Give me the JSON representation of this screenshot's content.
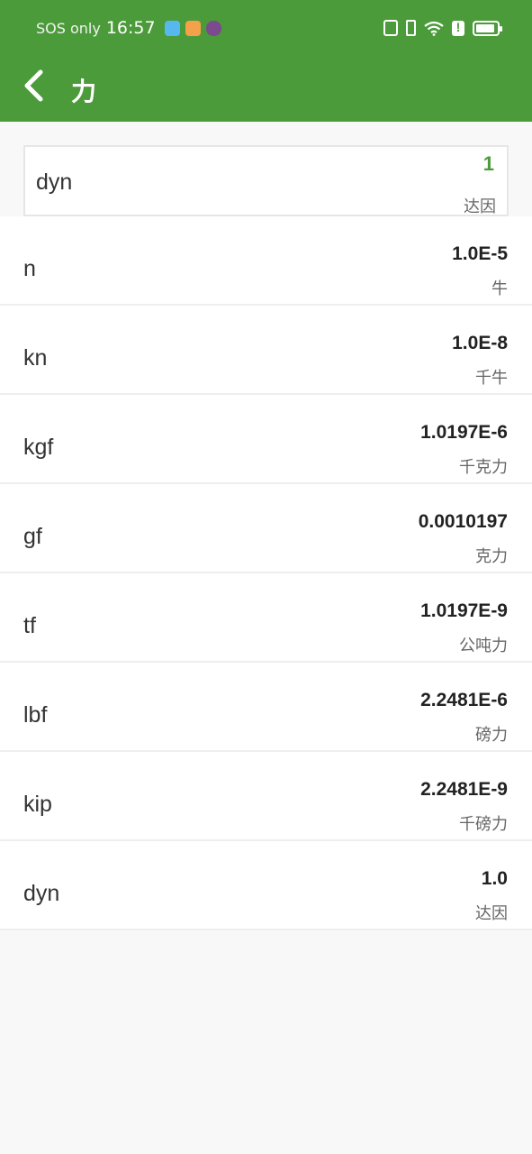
{
  "status_bar": {
    "carrier": "SOS only",
    "time": "16:57"
  },
  "header": {
    "title": "力",
    "back_icon": "chevron-left-icon",
    "color": "#4c9b3a"
  },
  "input": {
    "unit": "dyn",
    "value": "1",
    "name": "达因",
    "value_color": "#4c9b3a"
  },
  "results": [
    {
      "unit": "n",
      "value": "1.0E-5",
      "name": "牛"
    },
    {
      "unit": "kn",
      "value": "1.0E-8",
      "name": "千牛"
    },
    {
      "unit": "kgf",
      "value": "1.0197E-6",
      "name": "千克力"
    },
    {
      "unit": "gf",
      "value": "0.0010197",
      "name": "克力"
    },
    {
      "unit": "tf",
      "value": "1.0197E-9",
      "name": "公吨力"
    },
    {
      "unit": "lbf",
      "value": "2.2481E-6",
      "name": "磅力"
    },
    {
      "unit": "kip",
      "value": "2.2481E-9",
      "name": "千磅力"
    },
    {
      "unit": "dyn",
      "value": "1.0",
      "name": "达因"
    }
  ]
}
